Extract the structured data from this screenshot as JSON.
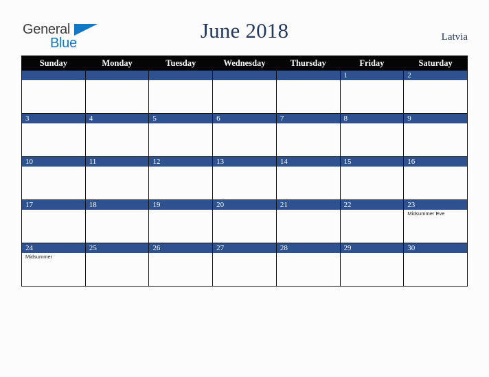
{
  "brand": {
    "name_part1": "General",
    "name_part2": "Blue",
    "triangle_color": "#1277c4",
    "text_color": "#3a3a3a"
  },
  "header": {
    "title": "June 2018",
    "country": "Latvia",
    "title_color": "#23395e"
  },
  "colors": {
    "header_row_bg": "#050505",
    "day_band_bg": "#2e5290",
    "cell_bg": "#fcfcfd",
    "grid_line": "#111111",
    "page_bg": "#fcfcfd"
  },
  "weekdays": [
    "Sunday",
    "Monday",
    "Tuesday",
    "Wednesday",
    "Thursday",
    "Friday",
    "Saturday"
  ],
  "weeks": [
    [
      {
        "day": "",
        "events": []
      },
      {
        "day": "",
        "events": []
      },
      {
        "day": "",
        "events": []
      },
      {
        "day": "",
        "events": []
      },
      {
        "day": "",
        "events": []
      },
      {
        "day": "1",
        "events": []
      },
      {
        "day": "2",
        "events": []
      }
    ],
    [
      {
        "day": "3",
        "events": []
      },
      {
        "day": "4",
        "events": []
      },
      {
        "day": "5",
        "events": []
      },
      {
        "day": "6",
        "events": []
      },
      {
        "day": "7",
        "events": []
      },
      {
        "day": "8",
        "events": []
      },
      {
        "day": "9",
        "events": []
      }
    ],
    [
      {
        "day": "10",
        "events": []
      },
      {
        "day": "11",
        "events": []
      },
      {
        "day": "12",
        "events": []
      },
      {
        "day": "13",
        "events": []
      },
      {
        "day": "14",
        "events": []
      },
      {
        "day": "15",
        "events": []
      },
      {
        "day": "16",
        "events": []
      }
    ],
    [
      {
        "day": "17",
        "events": []
      },
      {
        "day": "18",
        "events": []
      },
      {
        "day": "19",
        "events": []
      },
      {
        "day": "20",
        "events": []
      },
      {
        "day": "21",
        "events": []
      },
      {
        "day": "22",
        "events": []
      },
      {
        "day": "23",
        "events": [
          "Midsummer Eve"
        ]
      }
    ],
    [
      {
        "day": "24",
        "events": [
          "Midsummer"
        ]
      },
      {
        "day": "25",
        "events": []
      },
      {
        "day": "26",
        "events": []
      },
      {
        "day": "27",
        "events": []
      },
      {
        "day": "28",
        "events": []
      },
      {
        "day": "29",
        "events": []
      },
      {
        "day": "30",
        "events": []
      }
    ]
  ]
}
